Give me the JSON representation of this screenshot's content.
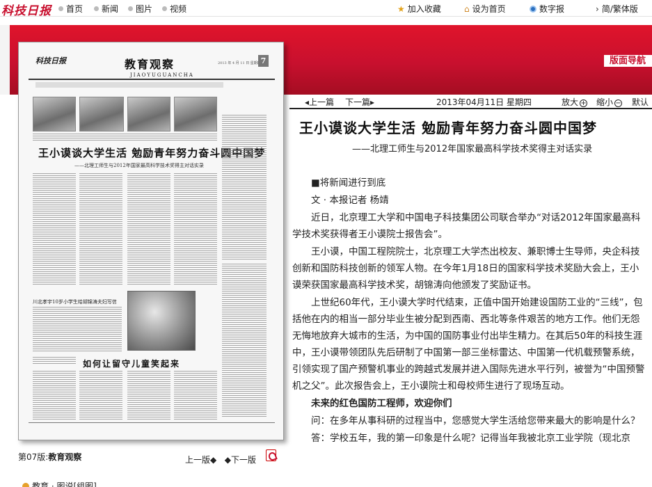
{
  "top_nav": {
    "logo": "科技日报",
    "links": [
      "首页",
      "新闻",
      "图片",
      "视频"
    ],
    "right_links": [
      "加入收藏",
      "设为首页",
      "数字报",
      "简/繁体版"
    ]
  },
  "banner": {
    "navigator_label": "版面导航"
  },
  "paper": {
    "masthead": "科技日报",
    "section_title": "教育观察",
    "section_en": "JIAOYUGUANCHA",
    "page_number": "7",
    "date_line": "2013 年 4 月 11 日  星期四",
    "headline": "王小谟谈大学生活  勉励青年努力奋斗圆中国梦",
    "subheadline": "——北理工师生与2012年国家最高科学技术奖得主对话实录",
    "bottom_headline": "如何让留守儿童笑起来",
    "box_title": "川北孝宇10岁小学生给胡锦涛夫妇写信"
  },
  "page_info": {
    "label_prefix": "第07版:",
    "label_section": "教育观察",
    "prev": "上一版",
    "next": "下一版"
  },
  "bottom_menu": {
    "text": "教育 · 图说[组图]"
  },
  "toolbar": {
    "prev_article": "上一篇",
    "next_article": "下一篇",
    "date": "2013年04月11日  星期四",
    "zoom_in": "放大",
    "zoom_out": "缩小",
    "default": "默认"
  },
  "article": {
    "title": "王小谟谈大学生活  勉励青年努力奋斗圆中国梦",
    "subtitle": "——北理工师生与2012年国家最高科学技术奖得主对话实录",
    "paragraphs": [
      "■将新闻进行到底",
      "文 · 本报记者  杨靖",
      "近日，北京理工大学和中国电子科技集团公司联合举办“对话2012年国家最高科学技术奖获得者王小谟院士报告会”。",
      "王小谟，中国工程院院士，北京理工大学杰出校友、兼职博士生导师，央企科技创新和国防科技创新的领军人物。在今年1月18日的国家科学技术奖励大会上，王小谟荣获国家最高科学技术奖，胡锦涛向他颁发了奖励证书。",
      "上世纪60年代，王小谟大学时代结束，正值中国开始建设国防工业的“三线”，包括他在内的相当一部分毕业生被分配到西南、西北等条件艰苦的地方工作。他们无怨无悔地放弃大城市的生活，为中国的国防事业付出毕生精力。在其后50年的科技生涯中，王小谟带领团队先后研制了中国第一部三坐标雷达、中国第一代机载预警系统，引领实现了国产预警机事业的跨越式发展并进入国际先进水平行列，被誉为“中国预警机之父”。此次报告会上，王小谟院士和母校师生进行了现场互动。",
      "未来的红色国防工程师，欢迎你们",
      "问：在多年从事科研的过程当中，您感觉大学生活给您带来最大的影响是什么？",
      "答：学校五年，我的第一印象是什么呢？记得当年我被北京工业学院（现北京"
    ]
  }
}
